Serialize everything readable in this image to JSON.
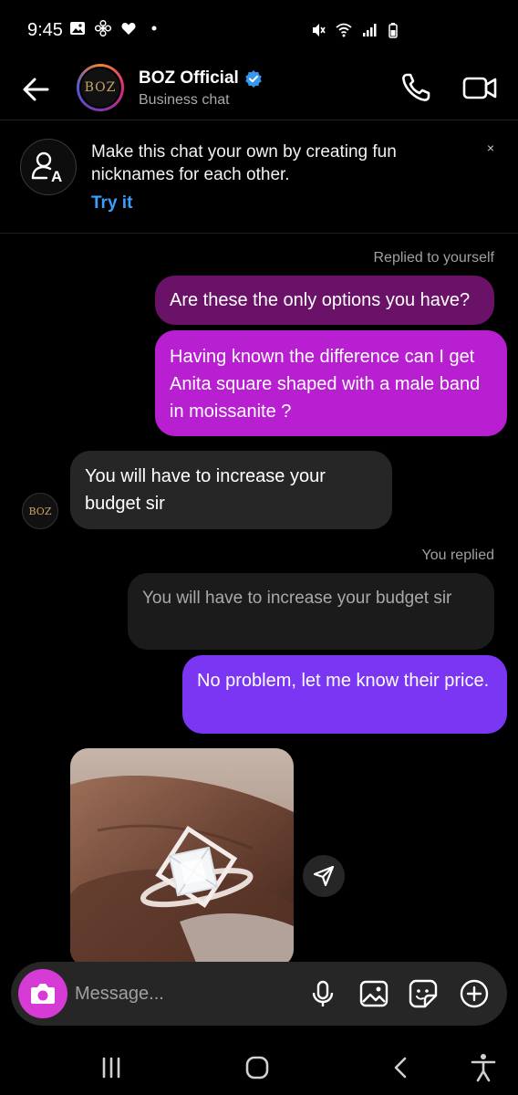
{
  "status_bar": {
    "time": "9:45",
    "icons": [
      "gallery-icon",
      "fan-icon",
      "heart-icon",
      "dot-icon",
      "mute-icon",
      "wifi-icon",
      "signal-icon",
      "battery-icon"
    ]
  },
  "header": {
    "name": "BOZ Official",
    "subtitle": "Business chat",
    "avatar_text": "BOZ",
    "verified": true
  },
  "banner": {
    "text": "Make this chat your own by creating fun nicknames for each other.",
    "link": "Try it",
    "close": "×"
  },
  "messages": [
    {
      "type": "label",
      "text": "Replied to yourself"
    },
    {
      "type": "outgoing-quoted",
      "text": "Are these the only options you have?"
    },
    {
      "type": "outgoing",
      "text": "Having known the difference can I get Anita square shaped with a male band in  moissanite ?"
    },
    {
      "type": "incoming",
      "text": "You will have to increase your budget sir"
    },
    {
      "type": "label",
      "text": "You replied"
    },
    {
      "type": "quoted",
      "text": "You will have to increase your budget sir"
    },
    {
      "type": "outgoing",
      "text": "No problem, let me know their price."
    }
  ],
  "small_avatar_text": "BOZ",
  "composer": {
    "placeholder": "Message..."
  },
  "colors": {
    "accent_link": "#3aa0ff",
    "bubble_dark": "#6a1268",
    "bubble_magenta": "#b81fd0",
    "bubble_purple": "#7a36f2",
    "bubble_incoming": "#262626",
    "camera": "#d63bd5"
  }
}
